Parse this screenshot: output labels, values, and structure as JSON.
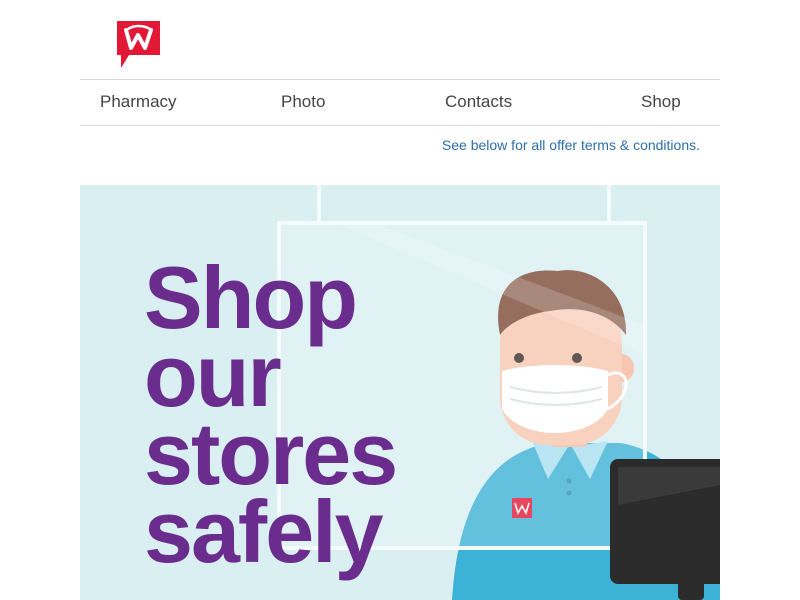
{
  "brand": {
    "logo_icon": "walgreens-w-logo-icon",
    "logo_letter": "W",
    "brand_color": "#e31837"
  },
  "nav": {
    "items": [
      {
        "label": "Pharmacy"
      },
      {
        "label": "Photo"
      },
      {
        "label": "Contacts"
      },
      {
        "label": "Shop"
      }
    ]
  },
  "terms_link": "See below for all offer terms & conditions.",
  "hero": {
    "headline_lines": [
      "Shop",
      "our",
      "stores",
      "safely"
    ],
    "headline_color": "#6b2d8d",
    "background_color": "#d9eff2",
    "illustration": "masked-pharmacist-behind-shield-illustration",
    "shirt_color": "#3cb2d6"
  }
}
